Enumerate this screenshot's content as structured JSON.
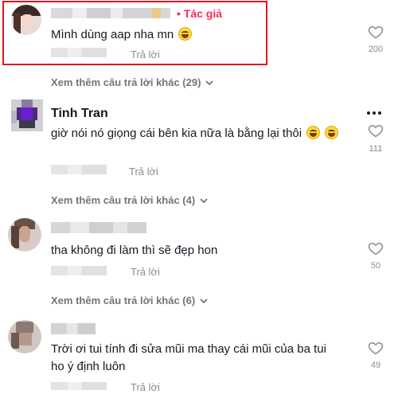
{
  "comments": [
    {
      "author_badge": "Tác giả",
      "text": "Mình dùng aap nha mn",
      "reply_label": "Trả lời",
      "likes": "200",
      "more_replies": "Xem thêm câu trả lời khác (29)"
    },
    {
      "author": "Tinh Tran",
      "text": "giờ nói nó giọng cái bên kia nữa là bằng lại thôi",
      "reply_label": "Trả lời",
      "likes": "111",
      "more_replies": "Xem thêm câu trả lời khác (4)"
    },
    {
      "text": "tha không đi làm thì sẽ đẹp hon",
      "reply_label": "Trả lời",
      "likes": "50",
      "more_replies": "Xem thêm câu trả lời khác (6)"
    },
    {
      "text_line1": "Trời ơi tui tính đi sửa mũi ma thay cái mũi của ba tui",
      "text_line2": "ho ý định luôn",
      "reply_label": "Trả lời",
      "likes": "49"
    }
  ],
  "colors": {
    "author_badge": "#fe2c55",
    "highlight_border": "#e1141d",
    "muted_text": "#8a8b91"
  },
  "icons": [
    "heart-outline-icon",
    "chevron-down-icon",
    "more-options-icon",
    "laughing-emoji-icon"
  ]
}
